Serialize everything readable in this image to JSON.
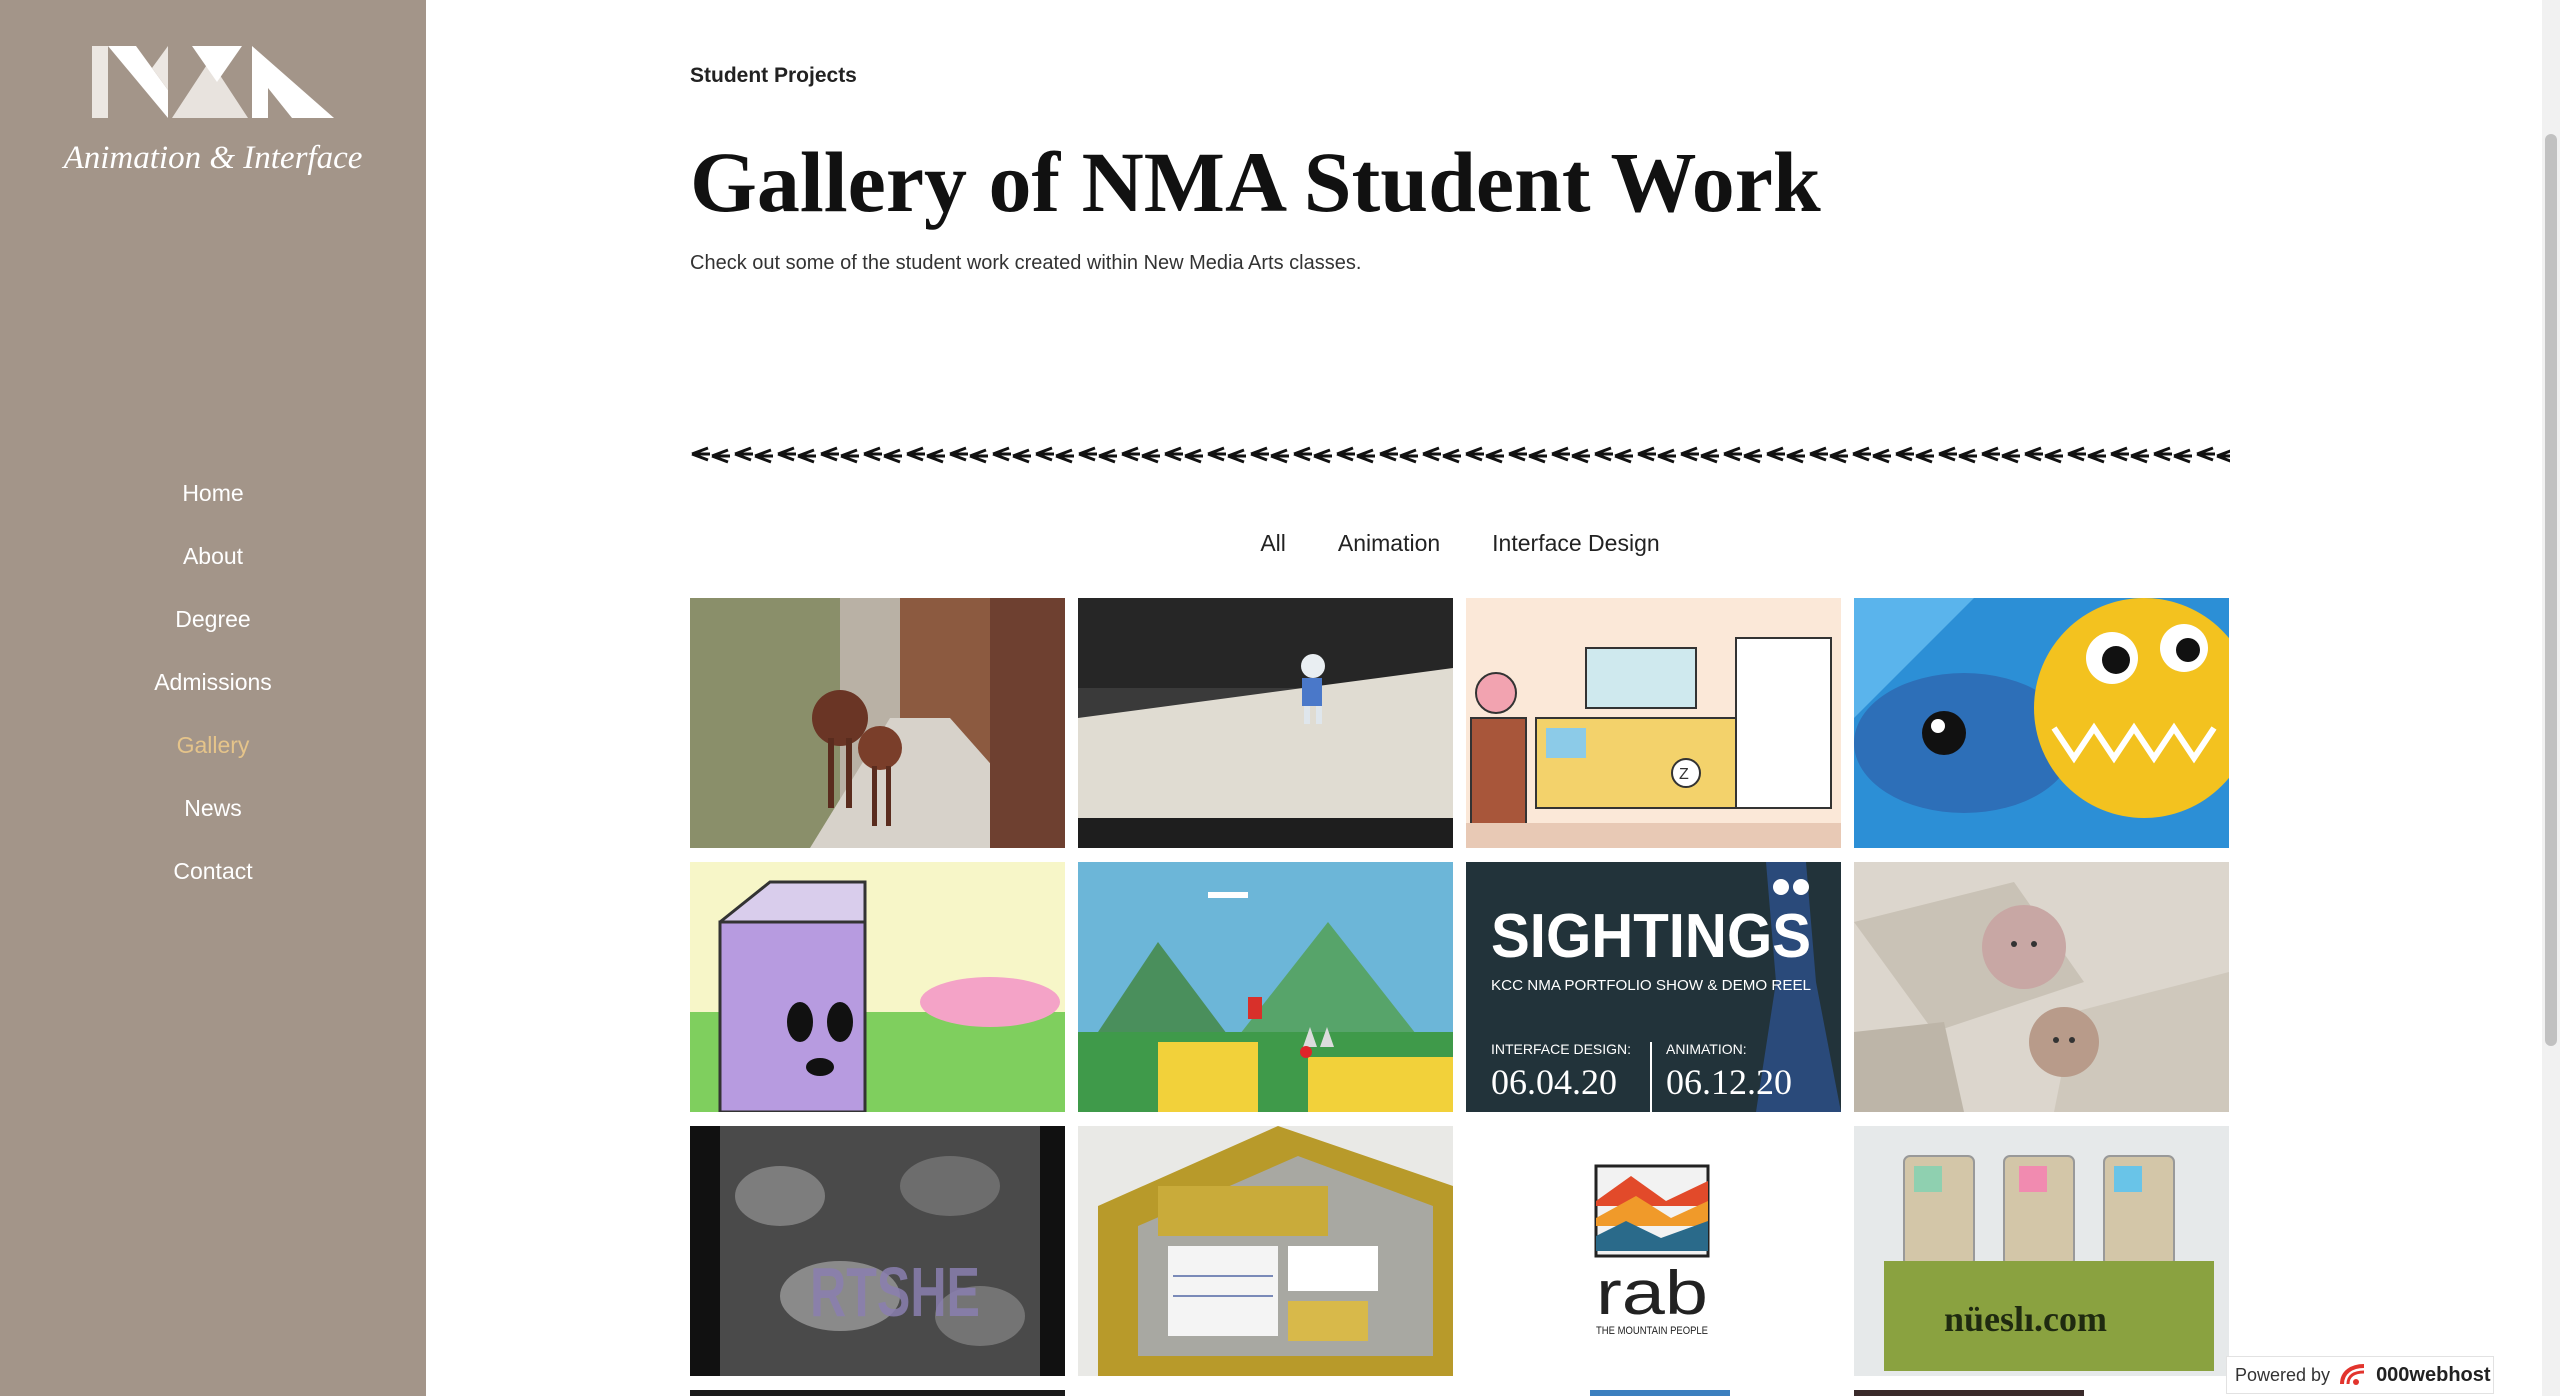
{
  "sidebar": {
    "logo_alt": "NMA",
    "tagline": "Animation & Interface",
    "nav": [
      {
        "label": "Home",
        "active": false
      },
      {
        "label": "About",
        "active": false
      },
      {
        "label": "Degree",
        "active": false
      },
      {
        "label": "Admissions",
        "active": false
      },
      {
        "label": "Gallery",
        "active": true
      },
      {
        "label": "News",
        "active": false
      },
      {
        "label": "Contact",
        "active": false
      }
    ]
  },
  "main": {
    "eyebrow": "Student Projects",
    "title": "Gallery of NMA Student Work",
    "intro": "Check out some of the student work created within New Media Arts classes."
  },
  "filters": [
    "All",
    "Animation",
    "Interface Design"
  ],
  "gallery": {
    "tiles": [
      {
        "name": "clay-creatures-photo"
      },
      {
        "name": "robot-figure-photo"
      },
      {
        "name": "kitchen-illustration"
      },
      {
        "name": "fish-illustration"
      },
      {
        "name": "milk-carton-illustration"
      },
      {
        "name": "platformer-game-screenshot"
      },
      {
        "name": "sightings-poster",
        "title": "SIGHTINGS",
        "subtitle": "KCC NMA PORTFOLIO SHOW & DEMO REEL",
        "left_label": "INTERFACE DESIGN:",
        "left_date": "06.04.20",
        "right_label": "ANIMATION:",
        "right_date": "06.12.20"
      },
      {
        "name": "clay-balls-photo"
      },
      {
        "name": "leaves-typography",
        "text": "RTSHE"
      },
      {
        "name": "stationery-kit-photo"
      },
      {
        "name": "rab-logo",
        "logo": "rab",
        "tag": "THE MOUNTAIN PEOPLE"
      },
      {
        "name": "nuesli-jars-photo",
        "text": "nüeslı.com"
      }
    ]
  },
  "badge": {
    "powered": "Powered by",
    "brand": "000webhost"
  },
  "colors": {
    "sidebar": "#a39589",
    "active_nav": "#e5c48a"
  }
}
